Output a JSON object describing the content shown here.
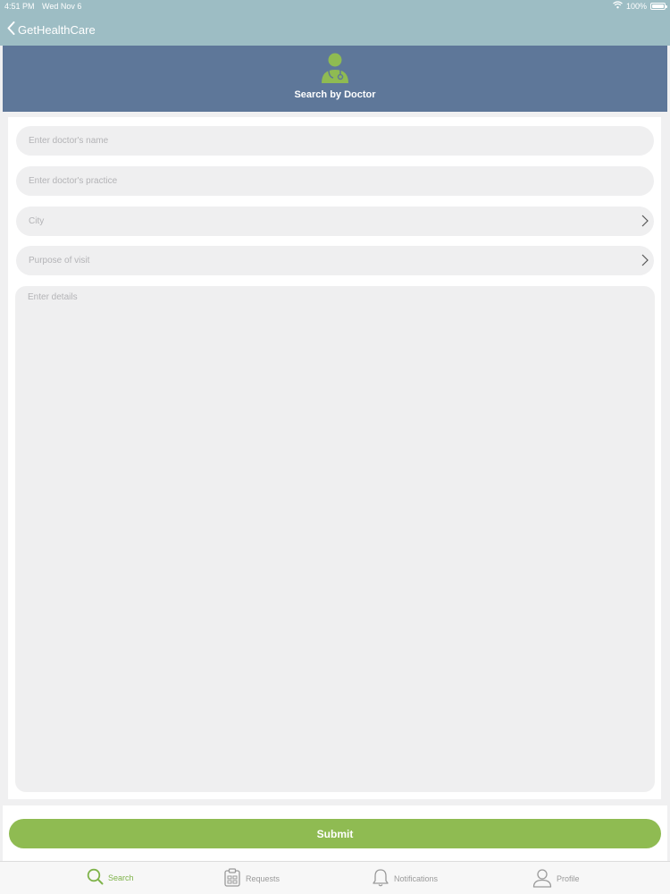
{
  "status_bar": {
    "time": "4:51 PM",
    "date": "Wed Nov 6",
    "battery": "100%"
  },
  "nav": {
    "back_label": "GetHealthCare"
  },
  "header": {
    "title": "Search by Doctor"
  },
  "form": {
    "doctor_name_placeholder": "Enter doctor's name",
    "doctor_practice_placeholder": "Enter doctor's practice",
    "city_placeholder": "City",
    "purpose_placeholder": "Purpose of visit",
    "details_placeholder": "Enter details"
  },
  "submit_label": "Submit",
  "tabs": [
    {
      "label": "Search",
      "icon": "search-icon",
      "active": true
    },
    {
      "label": "Requests",
      "icon": "clipboard-icon",
      "active": false
    },
    {
      "label": "Notifications",
      "icon": "bell-icon",
      "active": false
    },
    {
      "label": "Profile",
      "icon": "person-icon",
      "active": false
    }
  ],
  "colors": {
    "nav_bg": "#9dbdc4",
    "header_bg": "#5e7799",
    "accent_green": "#8fbb52",
    "field_bg": "#efeff0"
  }
}
